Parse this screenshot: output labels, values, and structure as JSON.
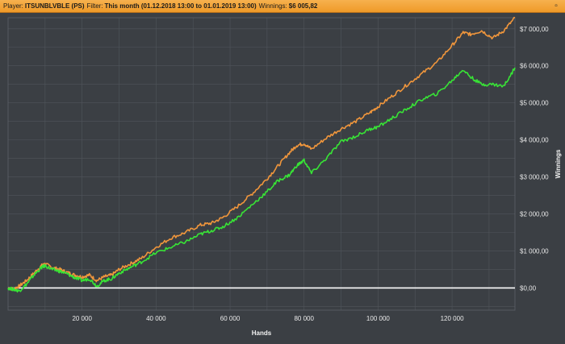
{
  "header": {
    "player_label": "Player:",
    "player_value": "ITSUNBLVBLE (PS)",
    "filter_label": "Filter:",
    "filter_value": "This month (01.12.2018 13:00 to 01.01.2019 13:00)",
    "winnings_label": "Winnings:",
    "winnings_value": "$6 005,82",
    "close_glyph": "▫"
  },
  "colors": {
    "background": "#3b3f44",
    "grid": "#50555b",
    "zero_line": "#ffffff",
    "orange_series": "#f0963c",
    "green_series": "#38e436"
  },
  "chart_data": {
    "type": "line",
    "xlabel": "Hands",
    "ylabel": "Winnings",
    "xlim": [
      0,
      137000
    ],
    "ylim": [
      -600,
      7300
    ],
    "x_ticks": [
      20000,
      40000,
      60000,
      80000,
      100000,
      120000
    ],
    "x_tick_labels": [
      "20 000",
      "40 000",
      "60 000",
      "80 000",
      "100 000",
      "120 000"
    ],
    "y_ticks": [
      0,
      1000,
      2000,
      3000,
      4000,
      5000,
      6000,
      7000
    ],
    "y_tick_labels": [
      "$0,00",
      "$1 000,00",
      "$2 000,00",
      "$3 000,00",
      "$4 000,00",
      "$5 000,00",
      "$6 000,00",
      "$7 000,00"
    ],
    "grid": true,
    "series": [
      {
        "color": "#f0963c",
        "x": [
          0,
          1500,
          3000,
          5000,
          7000,
          9000,
          10000,
          12000,
          14000,
          16000,
          18000,
          20000,
          22000,
          24000,
          26000,
          28000,
          30000,
          33000,
          36000,
          40000,
          44000,
          48000,
          52000,
          55000,
          58000,
          62000,
          66000,
          70000,
          73000,
          76000,
          78000,
          80000,
          82000,
          86000,
          90000,
          94000,
          98000,
          100000,
          104000,
          108000,
          112000,
          116000,
          120000,
          123000,
          125000,
          128000,
          131000,
          134000,
          137000
        ],
        "y": [
          0,
          -30,
          50,
          200,
          400,
          600,
          650,
          550,
          500,
          420,
          350,
          300,
          350,
          200,
          300,
          350,
          500,
          650,
          800,
          1100,
          1350,
          1500,
          1700,
          1750,
          1900,
          2200,
          2550,
          2950,
          3300,
          3650,
          3850,
          3900,
          3750,
          4050,
          4300,
          4500,
          4750,
          4900,
          5200,
          5500,
          5800,
          6100,
          6550,
          6900,
          6850,
          6950,
          6750,
          6950,
          7300
        ]
      },
      {
        "color": "#38e436",
        "x": [
          0,
          1500,
          3000,
          5000,
          7000,
          9000,
          10000,
          12000,
          14000,
          16000,
          18000,
          20000,
          22000,
          24000,
          26000,
          28000,
          30000,
          33000,
          36000,
          40000,
          44000,
          48000,
          52000,
          55000,
          58000,
          62000,
          66000,
          70000,
          73000,
          76000,
          78000,
          80000,
          82000,
          86000,
          90000,
          94000,
          98000,
          100000,
          104000,
          108000,
          112000,
          116000,
          120000,
          123000,
          125000,
          128000,
          131000,
          134000,
          137000
        ],
        "y": [
          0,
          -40,
          -80,
          100,
          350,
          550,
          600,
          500,
          450,
          380,
          280,
          200,
          250,
          50,
          200,
          250,
          400,
          550,
          700,
          950,
          1100,
          1250,
          1450,
          1550,
          1650,
          1900,
          2250,
          2600,
          2900,
          3050,
          3300,
          3450,
          3100,
          3500,
          3950,
          4100,
          4300,
          4350,
          4600,
          4850,
          5100,
          5250,
          5600,
          5900,
          5700,
          5500,
          5500,
          5450,
          5950
        ]
      }
    ]
  }
}
